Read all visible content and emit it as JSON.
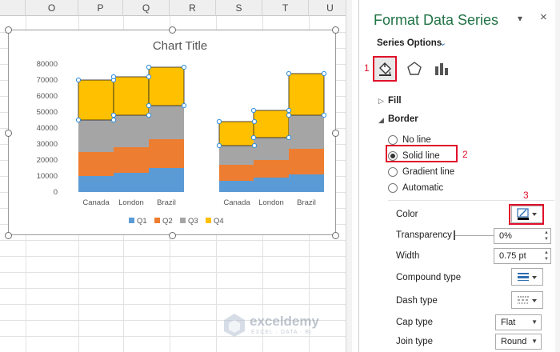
{
  "sheet": {
    "columns": [
      "O",
      "P",
      "Q",
      "R",
      "S",
      "T",
      "U"
    ]
  },
  "chart": {
    "title": "Chart Title",
    "legend": [
      "Q1",
      "Q2",
      "Q3",
      "Q4"
    ]
  },
  "chart_data": {
    "type": "bar",
    "stacked": true,
    "title": "Chart Title",
    "groups": [
      {
        "categories": [
          "Canada",
          "London",
          "Brazil"
        ]
      },
      {
        "categories": [
          "Canada",
          "London",
          "Brazil"
        ]
      }
    ],
    "categories": [
      "Canada",
      "London",
      "Brazil",
      "Canada",
      "London",
      "Brazil"
    ],
    "series": [
      {
        "name": "Q1",
        "color": "#5b9bd5",
        "values": [
          10000,
          12000,
          15000,
          7000,
          9000,
          11000
        ]
      },
      {
        "name": "Q2",
        "color": "#ed7d31",
        "values": [
          15000,
          16000,
          18000,
          10000,
          11000,
          16000
        ]
      },
      {
        "name": "Q3",
        "color": "#a5a5a5",
        "values": [
          20000,
          20000,
          21000,
          12000,
          14000,
          21000
        ]
      },
      {
        "name": "Q4",
        "color": "#ffc000",
        "values": [
          25000,
          24000,
          24000,
          15000,
          17000,
          26000
        ]
      }
    ],
    "yticks": [
      "0",
      "10000",
      "20000",
      "30000",
      "40000",
      "50000",
      "60000",
      "70000",
      "80000"
    ],
    "ylim": [
      0,
      80000
    ],
    "grid": false,
    "legend_position": "bottom",
    "selected_series": "Q4"
  },
  "pane": {
    "title": "Format Data Series",
    "series_options": "Series Options",
    "fill_label": "Fill",
    "border_label": "Border",
    "radios": [
      "No line",
      "Solid line",
      "Gradient line",
      "Automatic"
    ],
    "color_label": "Color",
    "transparency_label": "Transparency",
    "transparency_value": "0%",
    "width_label": "Width",
    "width_value": "0.75 pt",
    "compound_label": "Compound type",
    "dash_label": "Dash type",
    "cap_label": "Cap type",
    "cap_value": "Flat",
    "join_label": "Join type",
    "join_value": "Round"
  },
  "steps": [
    "1",
    "2",
    "3"
  ],
  "watermark": {
    "name": "exceldemy",
    "sub": "EXCEL · DATA · BI"
  },
  "colors": {
    "accent": "#217346",
    "highlight": "#e0102a"
  }
}
